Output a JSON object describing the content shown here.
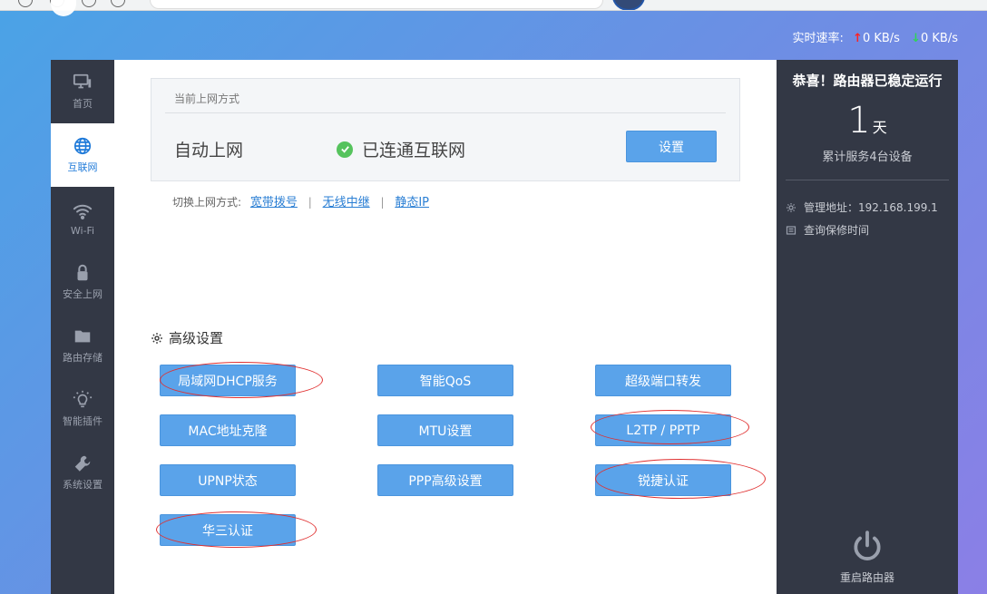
{
  "speed": {
    "label": "实时速率:",
    "up": "0 KB/s",
    "down": "0 KB/s"
  },
  "nav": [
    {
      "label": "首页",
      "icon": "monitor-icon"
    },
    {
      "label": "互联网",
      "icon": "globe-icon",
      "active": true
    },
    {
      "label": "Wi-Fi",
      "icon": "wifi-icon"
    },
    {
      "label": "安全上网",
      "icon": "lock-icon"
    },
    {
      "label": "路由存储",
      "icon": "folder-icon"
    },
    {
      "label": "智能插件",
      "icon": "bulb-icon"
    },
    {
      "label": "系统设置",
      "icon": "wrench-icon"
    }
  ],
  "wan": {
    "title": "当前上网方式",
    "mode": "自动上网",
    "status": "已连通互联网",
    "button": "设置"
  },
  "switch": {
    "label": "切换上网方式:",
    "options": [
      "宽带拨号",
      "无线中继",
      "静态IP"
    ]
  },
  "advanced": {
    "title": "高级设置",
    "buttons": [
      "局域网DHCP服务",
      "智能QoS",
      "超级端口转发",
      "MAC地址克隆",
      "MTU设置",
      "L2TP / PPTP",
      "UPNP状态",
      "PPP高级设置",
      "锐捷认证",
      "华三认证"
    ]
  },
  "panel": {
    "title": "恭喜！路由器已稳定运行",
    "days": "1",
    "days_unit": "天",
    "served": "累计服务4台设备",
    "admin_addr": "管理地址：192.168.199.1",
    "warranty": "查询保修时间",
    "restart": "重启路由器"
  },
  "colors": {
    "accent": "#5aa3ea",
    "sidebar": "#333845",
    "annotation": "#e03030"
  }
}
